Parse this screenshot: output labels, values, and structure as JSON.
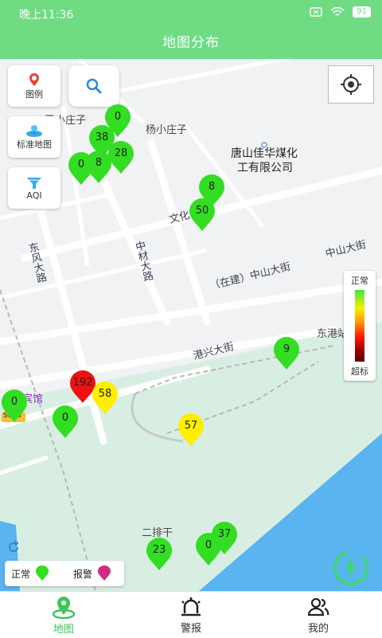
{
  "status": {
    "time": "晚上11:36",
    "battery": "91"
  },
  "header": {
    "title": "地图分布"
  },
  "map": {
    "controls": {
      "legend_label": "图例",
      "map_type_label": "标准地图",
      "aqi_label": "AQI"
    },
    "place_labels": {
      "yangxiaozhuangzi": "杨小庄子",
      "xiaozhuang_partial": "王小庄子",
      "company_line1": "唐山佳华煤化",
      "company_line2": "工有限公司",
      "erpaigan": "二排干",
      "donggang_partial": "东港站",
      "hotel_partial": "宾馆"
    },
    "road_labels": {
      "zhongshan": "中山大街",
      "zhongshan_construction": "（在建）中山大街",
      "dongfeng": "东风大路",
      "zhongcai": "中材大路",
      "wenhua": "文化",
      "gangxing": "港兴大街",
      "route_badge": "S044"
    },
    "scale_legend": {
      "top": "正常",
      "bottom": "超标"
    },
    "pins": [
      {
        "value": "0",
        "status": "normal"
      },
      {
        "value": "38",
        "status": "normal"
      },
      {
        "value": "28",
        "status": "normal"
      },
      {
        "value": "0",
        "status": "normal"
      },
      {
        "value": "8",
        "status": "normal"
      },
      {
        "value": "8",
        "status": "normal"
      },
      {
        "value": "50",
        "status": "normal"
      },
      {
        "value": "9",
        "status": "normal"
      },
      {
        "value": "192",
        "status": "alarm"
      },
      {
        "value": "58",
        "status": "warning"
      },
      {
        "value": "0",
        "status": "normal"
      },
      {
        "value": "0",
        "status": "normal"
      },
      {
        "value": "57",
        "status": "warning"
      },
      {
        "value": "37",
        "status": "normal"
      },
      {
        "value": "0",
        "status": "normal"
      },
      {
        "value": "23",
        "status": "normal"
      }
    ],
    "status_legend": {
      "normal_label": "正常",
      "alarm_label": "报警"
    }
  },
  "tabs": [
    {
      "label": "地图",
      "icon": "map-pin-icon",
      "active": true
    },
    {
      "label": "警报",
      "icon": "siren-icon",
      "active": false
    },
    {
      "label": "我的",
      "icon": "people-icon",
      "active": false
    }
  ],
  "colors": {
    "brand": "#6fdc84",
    "normal": "#33dd22",
    "warning": "#ffee00",
    "alarm": "#ee1111",
    "alarm_legend": "#d02a82"
  }
}
